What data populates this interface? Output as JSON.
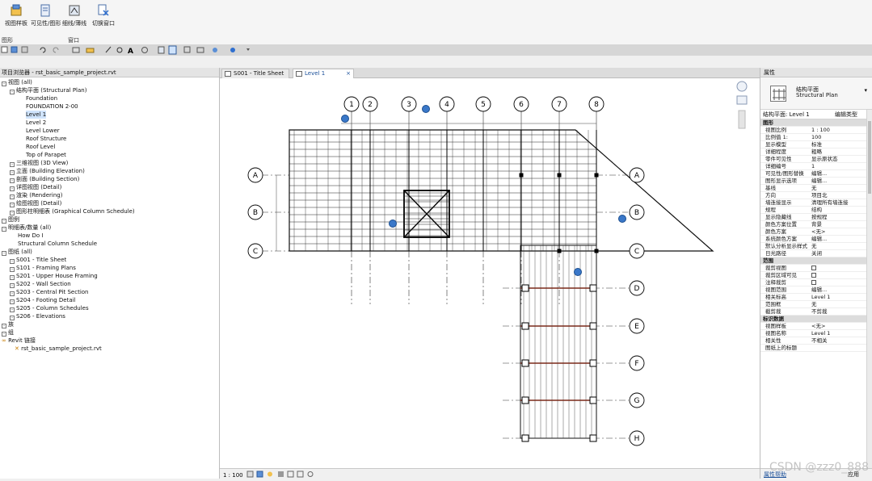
{
  "ribbon": {
    "buttons": [
      {
        "label": "视图样板"
      },
      {
        "label": "可见性/图形"
      },
      {
        "label": "细线/薄线"
      },
      {
        "label": "切换窗口"
      }
    ],
    "group_labels": [
      "图形",
      "窗口"
    ]
  },
  "project_browser": {
    "title": "项目浏览器 - rst_basic_sample_project.rvt",
    "items": [
      {
        "label": "视图 (all)"
      },
      {
        "label": "结构平面 (Structural Plan)"
      },
      {
        "label": "Foundation"
      },
      {
        "label": "FOUNDATION 2-00"
      },
      {
        "label": "Level 1"
      },
      {
        "label": "Level 2"
      },
      {
        "label": "Level Lower"
      },
      {
        "label": "Roof Structure"
      },
      {
        "label": "Roof Level"
      },
      {
        "label": "Top of Parapet"
      },
      {
        "label": "三维视图 (3D View)"
      },
      {
        "label": "立面 (Building Elevation)"
      },
      {
        "label": "剖面 (Building Section)"
      },
      {
        "label": "详图视图 (Detail)"
      },
      {
        "label": "渲染 (Rendering)"
      },
      {
        "label": "绘图视图 (Detail)"
      },
      {
        "label": "图形柱明细表 (Graphical Column Schedule)"
      },
      {
        "label": "图例"
      },
      {
        "label": "明细表/数量 (all)"
      },
      {
        "label": "How Do I"
      },
      {
        "label": "Structural Column Schedule"
      },
      {
        "label": "图纸 (all)"
      },
      {
        "label": "S001 - Title Sheet"
      },
      {
        "label": "S101 - Framing Plans"
      },
      {
        "label": "S201 - Upper House Framing"
      },
      {
        "label": "S202 - Wall Section"
      },
      {
        "label": "S203 - Central Pit Section"
      },
      {
        "label": "S204 - Footing Detail"
      },
      {
        "label": "S205 - Column Schedules"
      },
      {
        "label": "S206 - Elevations"
      },
      {
        "label": "族"
      },
      {
        "label": "组"
      },
      {
        "label": "Revit 链接"
      },
      {
        "label": "rst_basic_sample_project.rvt"
      }
    ]
  },
  "tabs": [
    {
      "label": "S001 - Title Sheet"
    },
    {
      "label": "Level 1"
    }
  ],
  "grid": {
    "vertical": [
      "1",
      "2",
      "3",
      "4",
      "5",
      "6",
      "7",
      "8"
    ],
    "horizontal": [
      "A",
      "B",
      "C",
      "D",
      "E",
      "F",
      "G",
      "H"
    ]
  },
  "properties": {
    "title": "属性",
    "type_line1": "结构平面",
    "type_line2": "Structural Plan",
    "selector_left": "结构平面: Level 1",
    "selector_right": "编辑类型",
    "rows": [
      {
        "k": "图形",
        "v": "",
        "section": true
      },
      {
        "k": "视图比例",
        "v": "1 : 100"
      },
      {
        "k": "比例值 1:",
        "v": "100"
      },
      {
        "k": "显示模型",
        "v": "标准"
      },
      {
        "k": "详细程度",
        "v": "粗略"
      },
      {
        "k": "零件可见性",
        "v": "显示原状态"
      },
      {
        "k": "详细编号",
        "v": "1"
      },
      {
        "k": "可见性/图形替换",
        "v": "编辑..."
      },
      {
        "k": "图形显示选项",
        "v": "编辑..."
      },
      {
        "k": "基线",
        "v": "无"
      },
      {
        "k": "方向",
        "v": "项目北"
      },
      {
        "k": "墙连接显示",
        "v": "清理所有墙连接"
      },
      {
        "k": "规程",
        "v": "结构"
      },
      {
        "k": "显示隐藏线",
        "v": "按规程"
      },
      {
        "k": "颜色方案位置",
        "v": "背景"
      },
      {
        "k": "颜色方案",
        "v": "<无>"
      },
      {
        "k": "系统颜色方案",
        "v": "编辑..."
      },
      {
        "k": "默认分析显示样式",
        "v": "无"
      },
      {
        "k": "日光路径",
        "v": "关闭"
      },
      {
        "k": "范围",
        "v": "",
        "section": true
      },
      {
        "k": "裁剪视图",
        "v": "",
        "check": true
      },
      {
        "k": "裁剪区域可见",
        "v": "",
        "check": true
      },
      {
        "k": "注释裁剪",
        "v": "",
        "check": true
      },
      {
        "k": "视图范围",
        "v": "编辑..."
      },
      {
        "k": "相关标高",
        "v": "Level 1"
      },
      {
        "k": "范围框",
        "v": "无"
      },
      {
        "k": "截剪裁",
        "v": "不剪裁"
      },
      {
        "k": "标识数据",
        "v": "",
        "section": true
      },
      {
        "k": "视图样板",
        "v": "<无>"
      },
      {
        "k": "视图名称",
        "v": "Level 1"
      },
      {
        "k": "相关性",
        "v": "不相关"
      },
      {
        "k": "图纸上的标题",
        "v": ""
      }
    ],
    "footer_link": "属性帮助",
    "footer_apply": "应用"
  },
  "watermark": "CSDN @zzz0_888"
}
